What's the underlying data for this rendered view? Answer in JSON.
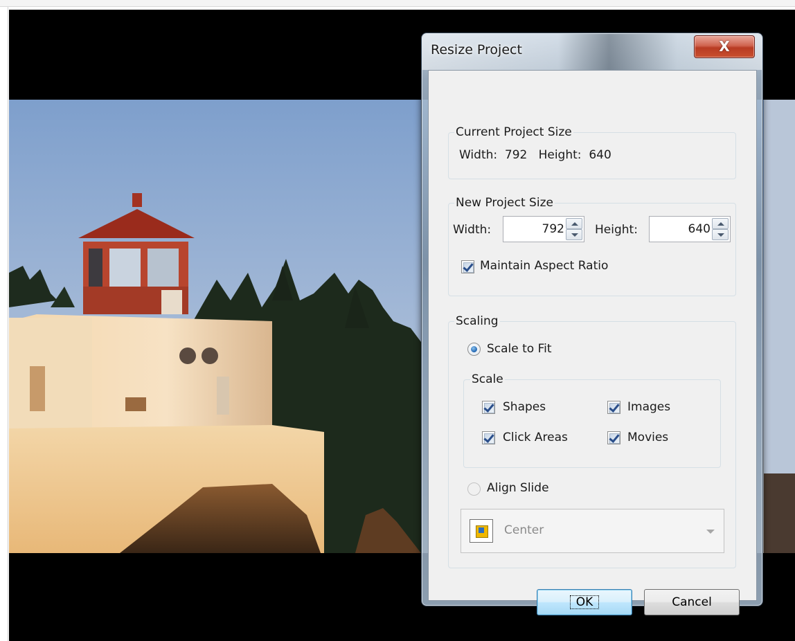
{
  "dialog": {
    "title": "Resize Project",
    "close_label": "X"
  },
  "current_size": {
    "legend": "Current Project Size",
    "text": "Width:  792   Height:  640"
  },
  "new_size": {
    "legend": "New Project Size",
    "width_label": "Width:",
    "width_value": "792",
    "height_label": "Height:",
    "height_value": "640",
    "aspect_label": "Maintain Aspect Ratio",
    "aspect_checked": true
  },
  "scaling": {
    "legend": "Scaling",
    "scale_to_fit_label": "Scale to Fit",
    "scale_to_fit_selected": true,
    "scale_group_legend": "Scale",
    "options": [
      {
        "label": "Shapes",
        "checked": true
      },
      {
        "label": "Images",
        "checked": true
      },
      {
        "label": "Click Areas",
        "checked": true
      },
      {
        "label": "Movies",
        "checked": true
      }
    ],
    "align_slide_label": "Align Slide",
    "align_slide_selected": false,
    "align_value": "Center"
  },
  "buttons": {
    "ok": "OK",
    "cancel": "Cancel"
  },
  "colors": {
    "sky": "#8fb0d8",
    "lighthouse_roof": "#9a2b1c",
    "close_button": "#c9502f"
  }
}
